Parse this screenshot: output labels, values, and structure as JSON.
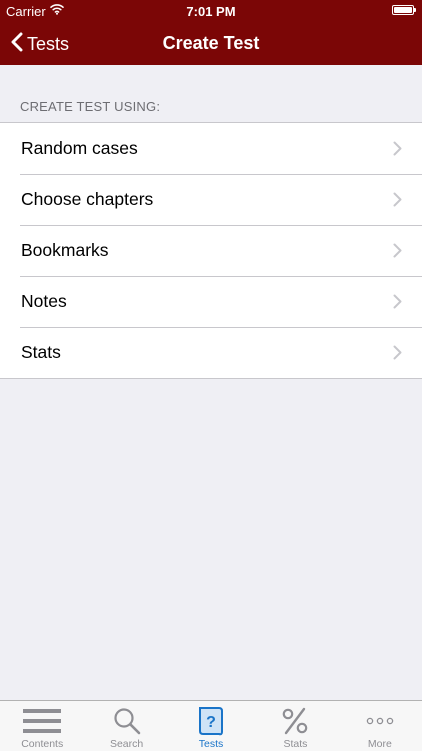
{
  "status_bar": {
    "carrier": "Carrier",
    "time": "7:01 PM"
  },
  "nav": {
    "back_label": "Tests",
    "title": "Create Test"
  },
  "section": {
    "header": "CREATE TEST USING:"
  },
  "rows": [
    {
      "label": "Random cases"
    },
    {
      "label": "Choose chapters"
    },
    {
      "label": "Bookmarks"
    },
    {
      "label": "Notes"
    },
    {
      "label": "Stats"
    }
  ],
  "tabbar": {
    "active": "Tests",
    "tabs": [
      {
        "label": "Contents",
        "icon": "list-icon"
      },
      {
        "label": "Search",
        "icon": "search-icon"
      },
      {
        "label": "Tests",
        "icon": "question-card-icon"
      },
      {
        "label": "Stats",
        "icon": "percent-icon"
      },
      {
        "label": "More",
        "icon": "more-dots-icon"
      }
    ]
  },
  "colors": {
    "nav_background": "#7b0606",
    "page_background": "#efeff4",
    "active_tab": "#1a74c8",
    "inactive_tab": "#8e8e93"
  }
}
